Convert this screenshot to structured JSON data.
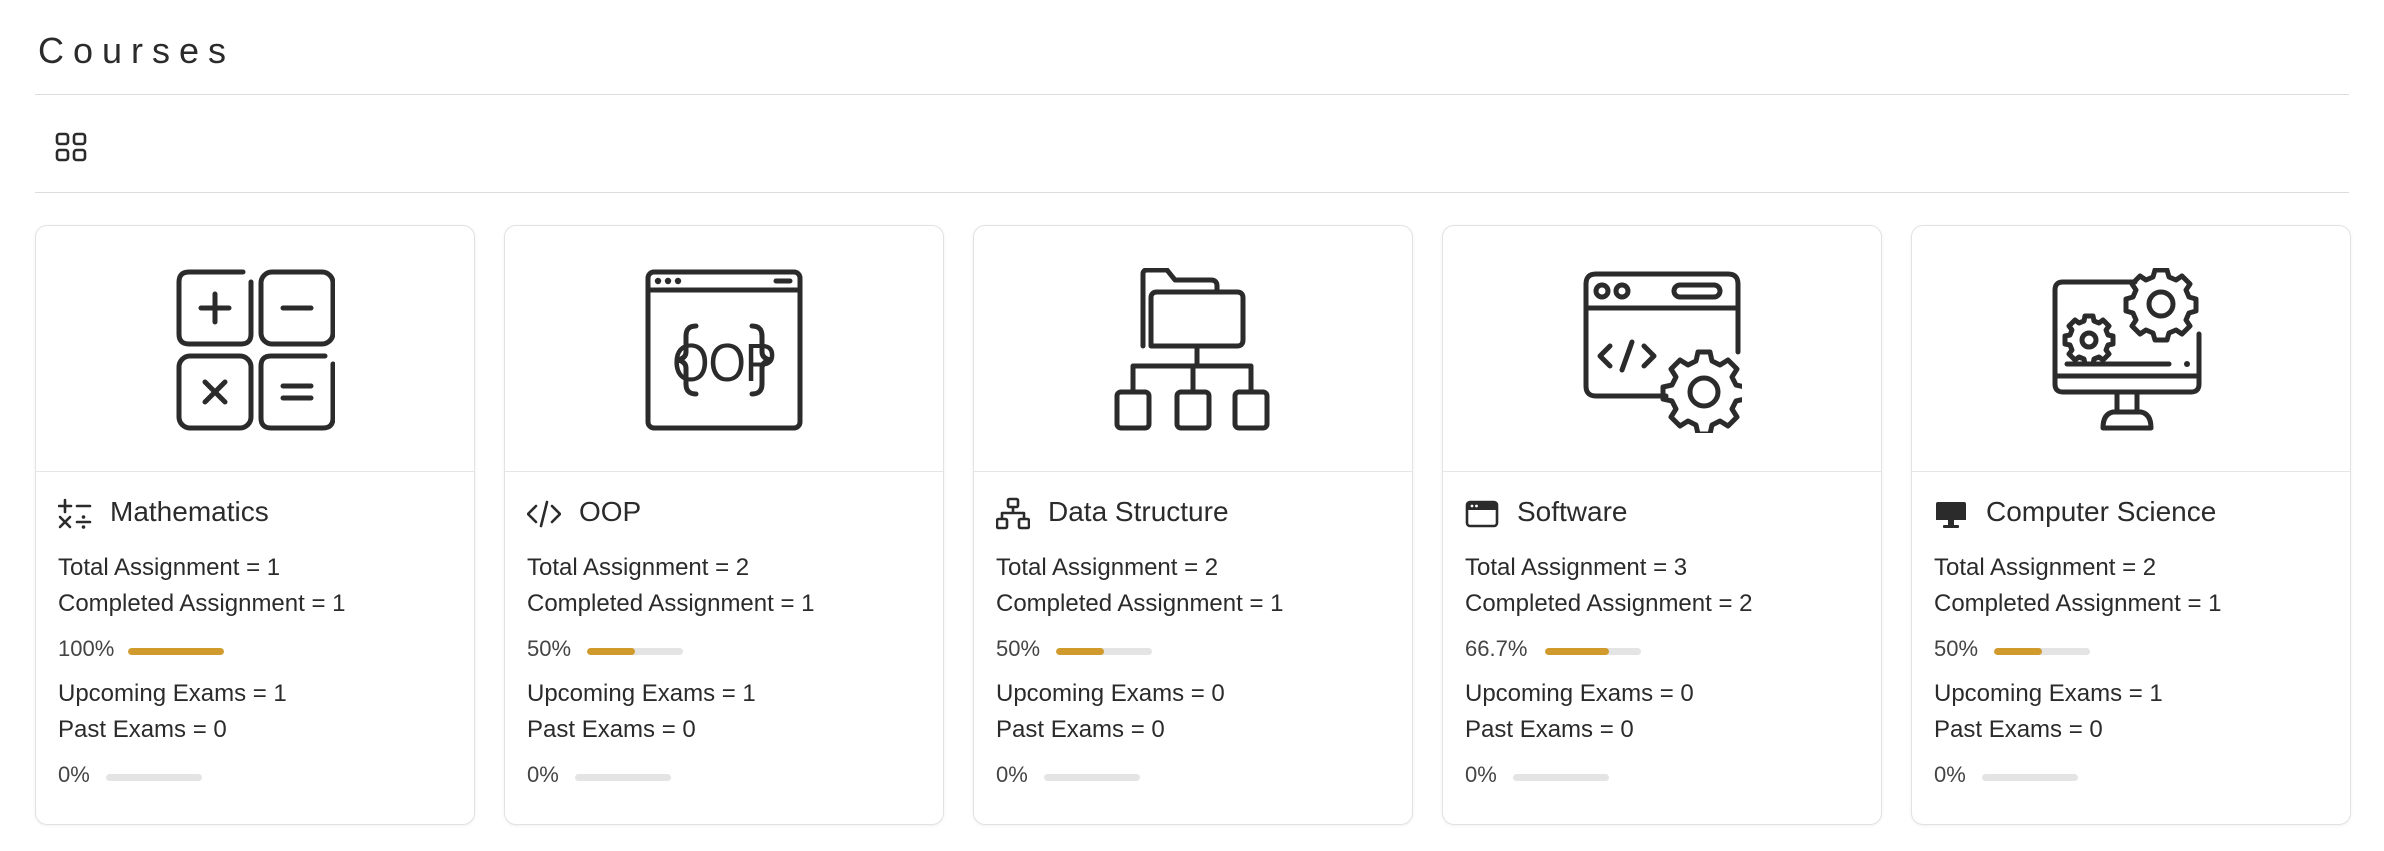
{
  "page": {
    "title": "Courses"
  },
  "toolbar": {
    "view_toggle_icon": "grid-view-icon"
  },
  "colors": {
    "progress_fill": "#d09b2c",
    "progress_track": "#e4e4e4",
    "text": "#2b2b2b"
  },
  "courses": [
    {
      "name": "Mathematics",
      "image_icon": "calculator-operations-icon",
      "small_icon": "math-operations-icon",
      "total_assignment": "Total Assignment = 1",
      "completed_assignment": "Completed Assignment = 1",
      "assignment_progress_label": "100%",
      "assignment_progress": 1.0,
      "upcoming_exams": "Upcoming Exams = 1",
      "past_exams": "Past Exams = 0",
      "exam_progress_label": "0%",
      "exam_progress": 0.0
    },
    {
      "name": "OOP",
      "image_icon": "oop-browser-icon",
      "small_icon": "code-icon",
      "total_assignment": "Total Assignment = 2",
      "completed_assignment": "Completed Assignment = 1",
      "assignment_progress_label": "50%",
      "assignment_progress": 0.5,
      "upcoming_exams": "Upcoming Exams = 1",
      "past_exams": "Past Exams = 0",
      "exam_progress_label": "0%",
      "exam_progress": 0.0
    },
    {
      "name": "Data Structure",
      "image_icon": "folder-tree-icon",
      "small_icon": "hierarchy-icon",
      "total_assignment": "Total Assignment = 2",
      "completed_assignment": "Completed Assignment = 1",
      "assignment_progress_label": "50%",
      "assignment_progress": 0.5,
      "upcoming_exams": "Upcoming Exams = 0",
      "past_exams": "Past Exams = 0",
      "exam_progress_label": "0%",
      "exam_progress": 0.0
    },
    {
      "name": "Software",
      "image_icon": "browser-code-gear-icon",
      "small_icon": "browser-window-icon",
      "total_assignment": "Total Assignment = 3",
      "completed_assignment": "Completed Assignment = 2",
      "assignment_progress_label": "66.7%",
      "assignment_progress": 0.667,
      "upcoming_exams": "Upcoming Exams = 0",
      "past_exams": "Past Exams = 0",
      "exam_progress_label": "0%",
      "exam_progress": 0.0
    },
    {
      "name": "Computer Science",
      "image_icon": "monitor-gears-icon",
      "small_icon": "desktop-computer-icon",
      "total_assignment": "Total Assignment = 2",
      "completed_assignment": "Completed Assignment = 1",
      "assignment_progress_label": "50%",
      "assignment_progress": 0.5,
      "upcoming_exams": "Upcoming Exams = 1",
      "past_exams": "Past Exams = 0",
      "exam_progress_label": "0%",
      "exam_progress": 0.0
    }
  ]
}
